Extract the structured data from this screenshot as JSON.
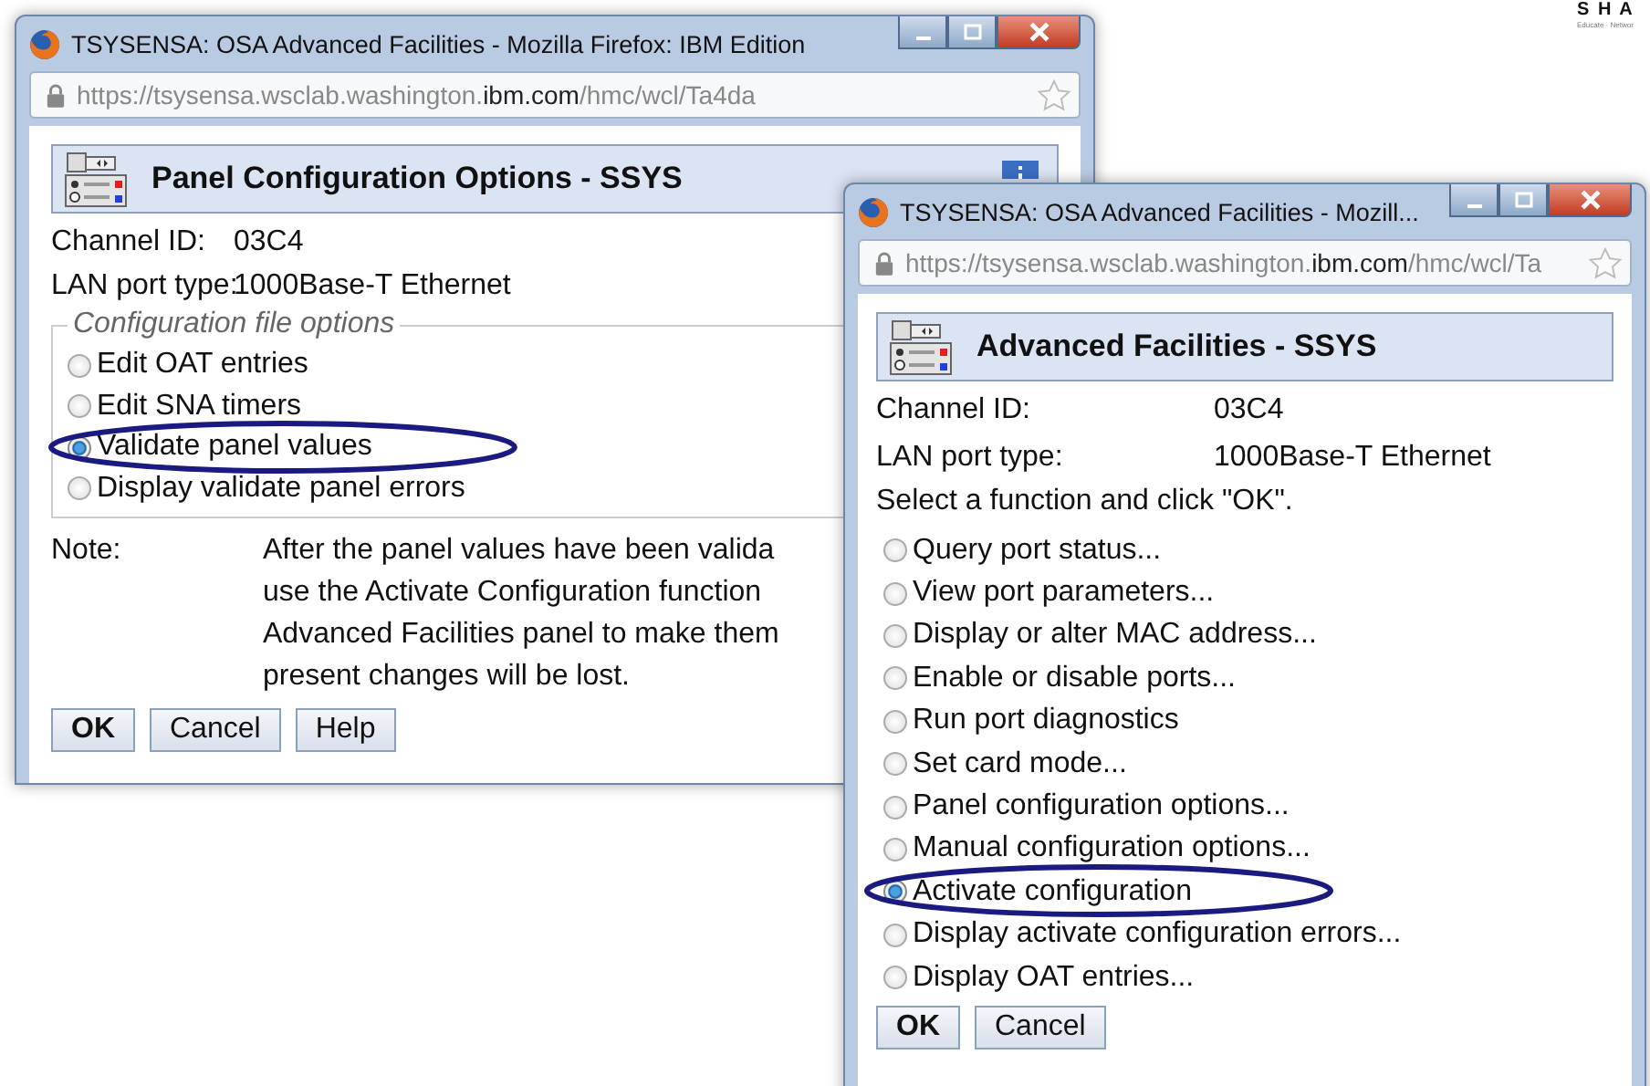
{
  "logo": {
    "mark": "S H A",
    "tagline": "Educate · Networ"
  },
  "windows": [
    {
      "title": "TSYSENSA: OSA Advanced Facilities - Mozilla Firefox: IBM Edition",
      "url": "https://tsysensa.wsclab.washington.**ibm.com**/hmc/wcl/Ta4da",
      "panel_title": "Panel Configuration Options - SSYS",
      "info_button": true,
      "fields": [
        {
          "label": "Channel ID:",
          "value": "03C4"
        },
        {
          "label": "LAN port type:",
          "value": "1000Base-T Ethernet"
        }
      ],
      "options_group": {
        "legend": "Configuration file options",
        "options": [
          {
            "label": "Edit OAT entries",
            "selected": false,
            "circled": false
          },
          {
            "label": "Edit SNA timers",
            "selected": false,
            "circled": false
          },
          {
            "label": "Validate panel values",
            "selected": true,
            "circled": true
          },
          {
            "label": "Display validate panel errors",
            "selected": false,
            "circled": false
          }
        ]
      },
      "note": {
        "label": "Note:",
        "lines": [
          "After the panel values have been valida",
          "use the Activate Configuration function",
          "Advanced Facilities panel to make them",
          "present changes will be lost."
        ]
      },
      "buttons": [
        {
          "label": "OK",
          "default": true
        },
        {
          "label": "Cancel",
          "default": false
        },
        {
          "label": "Help",
          "default": false
        }
      ]
    },
    {
      "title": "TSYSENSA: OSA Advanced Facilities - Mozill...",
      "url": "https://tsysensa.wsclab.washington.**ibm.com**/hmc/wcl/Ta",
      "panel_title": "Advanced Facilities - SSYS",
      "info_button": false,
      "fields": [
        {
          "label": "Channel ID:",
          "value": "03C4"
        },
        {
          "label": "LAN port type:",
          "value": "1000Base-T Ethernet"
        }
      ],
      "instruction": "Select a function and click \"OK\".",
      "options": [
        {
          "label": "Query port status...",
          "selected": false,
          "circled": false
        },
        {
          "label": "View port parameters...",
          "selected": false,
          "circled": false
        },
        {
          "label": "Display or alter MAC address...",
          "selected": false,
          "circled": false
        },
        {
          "label": "Enable or disable ports...",
          "selected": false,
          "circled": false
        },
        {
          "label": "Run port diagnostics",
          "selected": false,
          "circled": false
        },
        {
          "label": "Set card mode...",
          "selected": false,
          "circled": false
        },
        {
          "label": "Panel configuration options...",
          "selected": false,
          "circled": false
        },
        {
          "label": "Manual configuration options...",
          "selected": false,
          "circled": false
        },
        {
          "label": "Activate configuration",
          "selected": true,
          "circled": true
        },
        {
          "label": "Display activate configuration errors...",
          "selected": false,
          "circled": false
        },
        {
          "label": "Display OAT entries...",
          "selected": false,
          "circled": false
        }
      ],
      "buttons": [
        {
          "label": "OK",
          "default": true
        },
        {
          "label": "Cancel",
          "default": false
        }
      ]
    }
  ]
}
